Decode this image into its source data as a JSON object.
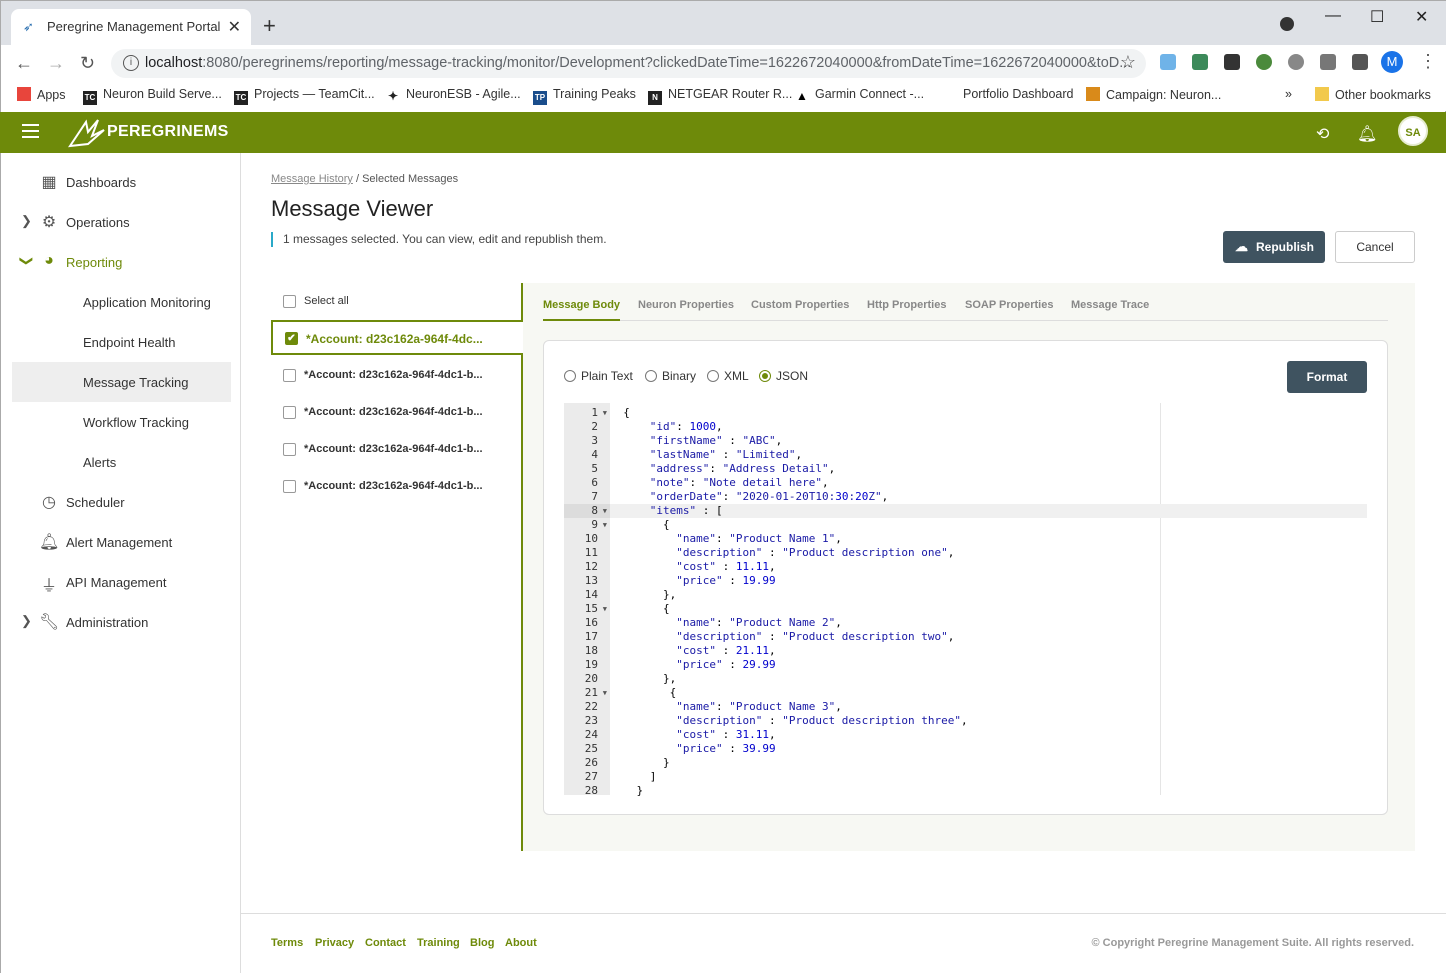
{
  "browser": {
    "tab_title": "Peregrine Management Portal",
    "url_host": "localhost",
    "url_rest": ":8080/peregrinems/reporting/message-tracking/monitor/Development?clickedDateTime=1622672040000&fromDateTime=1622672040000&toD...",
    "avatar_letter": "M",
    "bookmarks": [
      "Apps",
      "Neuron Build Serve...",
      "Projects — TeamCit...",
      "NeuronESB - Agile...",
      "Training Peaks",
      "NETGEAR Router R...",
      "Garmin Connect -...",
      "Portfolio Dashboard",
      "Campaign: Neuron..."
    ],
    "bookmarks_overflow": "»",
    "other_bookmarks": "Other bookmarks"
  },
  "appbar": {
    "logo_text": "PEREGRINEMS",
    "user_initials": "SA",
    "color": "#6e8a0a"
  },
  "sidebar": {
    "items": [
      {
        "label": "Dashboards",
        "icon": "dashboard-icon"
      },
      {
        "label": "Operations",
        "icon": "gear-icon"
      },
      {
        "label": "Reporting",
        "icon": "pie-chart-icon"
      },
      {
        "label": "Application Monitoring"
      },
      {
        "label": "Endpoint Health"
      },
      {
        "label": "Message Tracking"
      },
      {
        "label": "Workflow Tracking"
      },
      {
        "label": "Alerts"
      },
      {
        "label": "Scheduler",
        "icon": "clock-icon"
      },
      {
        "label": "Alert Management",
        "icon": "bell-icon"
      },
      {
        "label": "API Management",
        "icon": "plug-icon"
      },
      {
        "label": "Administration",
        "icon": "wrench-icon"
      }
    ]
  },
  "page": {
    "breadcrumb_link": "Message History",
    "breadcrumb_sep": " / ",
    "breadcrumb_current": "Selected Messages",
    "title": "Message Viewer",
    "subtitle": "1 messages selected. You can view, edit and republish them.",
    "republish_label": "Republish",
    "cancel_label": "Cancel"
  },
  "messages": {
    "select_all": "Select all",
    "items": [
      {
        "label": "*Account: d23c162a-964f-4dc...",
        "checked": true
      },
      {
        "label": "*Account: d23c162a-964f-4dc1-b...",
        "checked": false
      },
      {
        "label": "*Account: d23c162a-964f-4dc1-b...",
        "checked": false
      },
      {
        "label": "*Account: d23c162a-964f-4dc1-b...",
        "checked": false
      },
      {
        "label": "*Account: d23c162a-964f-4dc1-b...",
        "checked": false
      }
    ]
  },
  "detail": {
    "tabs": [
      "Message Body",
      "Neuron Properties",
      "Custom Properties",
      "Http Properties",
      "SOAP Properties",
      "Message Trace"
    ],
    "active_tab": 0,
    "formats": [
      "Plain Text",
      "Binary",
      "XML",
      "JSON"
    ],
    "selected_format": "JSON",
    "format_label": "Format",
    "code_lines": [
      "{",
      "    \"id\": 1000,",
      "    \"firstName\" : \"ABC\",",
      "    \"lastName\" : \"Limited\",",
      "    \"address\": \"Address Detail\",",
      "    \"note\": \"Note detail here\",",
      "    \"orderDate\": \"2020-01-20T10:30:20Z\",",
      "    \"items\" : [",
      "      {",
      "        \"name\": \"Product Name 1\",",
      "        \"description\" : \"Product description one\",",
      "        \"cost\" : 11.11,",
      "        \"price\" : 19.99",
      "      },",
      "      {",
      "        \"name\": \"Product Name 2\",",
      "        \"description\" : \"Product description two\",",
      "        \"cost\" : 21.11,",
      "        \"price\" : 29.99",
      "      },",
      "       {",
      "        \"name\": \"Product Name 3\",",
      "        \"description\" : \"Product description three\",",
      "        \"cost\" : 31.11,",
      "        \"price\" : 39.99",
      "      }",
      "    ]",
      "  }"
    ],
    "active_line": 8,
    "fold_lines": [
      1,
      8,
      9,
      15,
      21
    ]
  },
  "footer": {
    "links": [
      "Terms",
      "Privacy",
      "Contact",
      "Training",
      "Blog",
      "About"
    ],
    "copyright": "© Copyright Peregrine Management Suite. All rights reserved."
  }
}
